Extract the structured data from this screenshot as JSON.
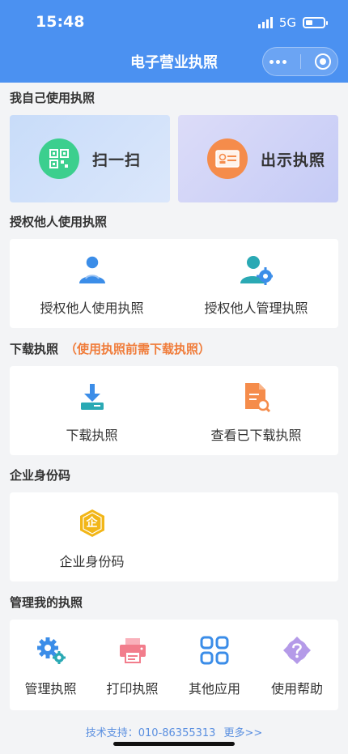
{
  "status_bar": {
    "time": "15:48",
    "network": "5G"
  },
  "header": {
    "title": "电子营业执照"
  },
  "self_use": {
    "title": "我自己使用执照",
    "scan_label": "扫一扫",
    "show_label": "出示执照"
  },
  "authorize": {
    "title": "授权他人使用执照",
    "items": [
      {
        "label": "授权他人使用执照"
      },
      {
        "label": "授权他人管理执照"
      }
    ]
  },
  "download": {
    "title": "下载执照",
    "hint": "（使用执照前需下载执照）",
    "items": [
      {
        "label": "下载执照"
      },
      {
        "label": "查看已下载执照"
      }
    ]
  },
  "enterprise_id": {
    "title": "企业身份码",
    "item_label": "企业身份码",
    "badge_char": "企"
  },
  "manage": {
    "title": "管理我的执照",
    "items": [
      {
        "label": "管理执照"
      },
      {
        "label": "打印执照"
      },
      {
        "label": "其他应用"
      },
      {
        "label": "使用帮助"
      }
    ]
  },
  "footer": {
    "support_text": "技术支持：010-86355313",
    "more_link": "更多>>"
  },
  "colors": {
    "header_blue": "#4b91f1",
    "hint_orange": "#f07c3a",
    "scan_green": "#3ccf8e",
    "license_orange": "#f58c4b",
    "icon_blue": "#3b8de8",
    "print_pink": "#f27d8c",
    "help_purple": "#b49ae8",
    "badge_yellow": "#f2b618"
  }
}
